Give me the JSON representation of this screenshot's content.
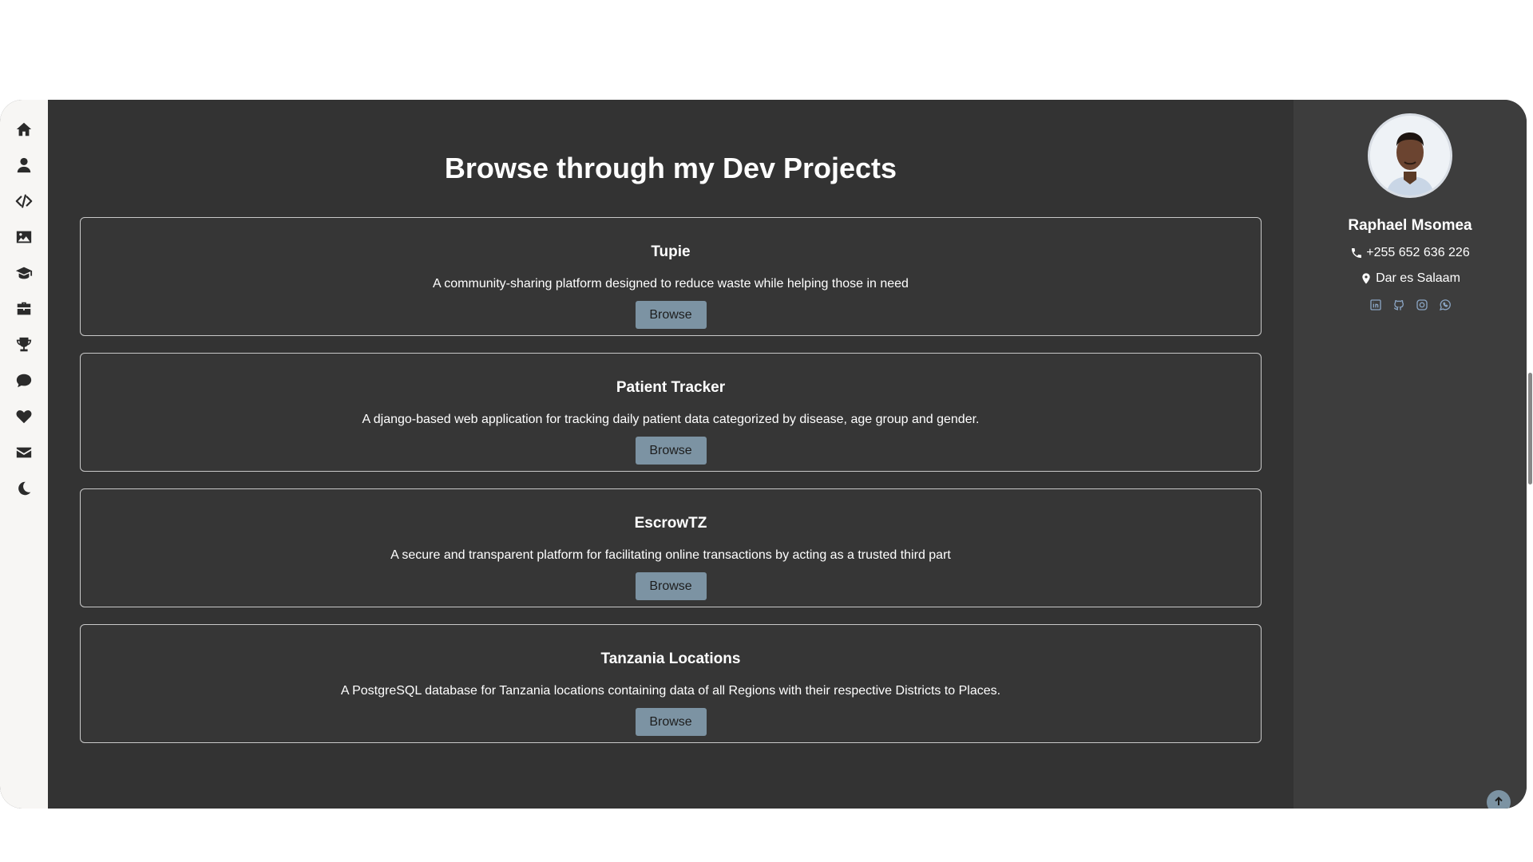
{
  "sidebar": {
    "items": [
      {
        "icon": "home-icon"
      },
      {
        "icon": "user-icon"
      },
      {
        "icon": "code-icon"
      },
      {
        "icon": "image-icon"
      },
      {
        "icon": "graduation-cap-icon"
      },
      {
        "icon": "briefcase-icon"
      },
      {
        "icon": "trophy-icon"
      },
      {
        "icon": "comment-icon"
      },
      {
        "icon": "heart-icon"
      },
      {
        "icon": "envelope-icon"
      },
      {
        "icon": "moon-icon"
      }
    ]
  },
  "main": {
    "title": "Browse through my Dev Projects",
    "projects": [
      {
        "title": "Tupie",
        "description": "A community-sharing platform designed to reduce waste while helping those in need",
        "button": "Browse"
      },
      {
        "title": "Patient Tracker",
        "description": "A django-based web application for tracking daily patient data categorized by disease, age group and gender.",
        "button": "Browse"
      },
      {
        "title": "EscrowTZ",
        "description": "A secure and transparent platform for facilitating online transactions by acting as a trusted third part",
        "button": "Browse"
      },
      {
        "title": "Tanzania Locations",
        "description": "A PostgreSQL database for Tanzania locations containing data of all Regions with their respective Districts to Places.",
        "button": "Browse"
      }
    ]
  },
  "profile": {
    "name": "Raphael Msomea",
    "phone": "+255 652 636 226",
    "location": "Dar es Salaam",
    "socials": [
      "linkedin-icon",
      "github-icon",
      "instagram-icon",
      "whatsapp-icon"
    ]
  },
  "colors": {
    "accent": "#7c93a3",
    "main_bg": "#333333",
    "profile_bg": "#3d3d3d",
    "sidebar_bg": "#f7f6f4"
  }
}
